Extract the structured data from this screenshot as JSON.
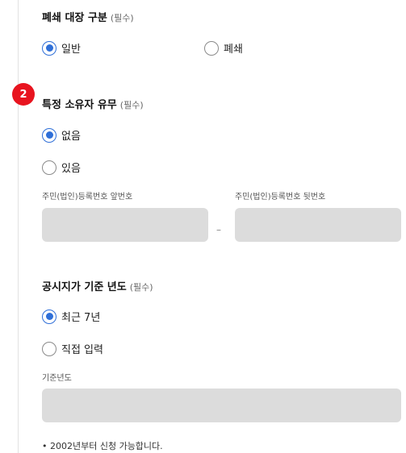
{
  "section_closure": {
    "title": "폐쇄 대장 구분",
    "required": "(필수)",
    "options": [
      "일반",
      "폐쇄"
    ],
    "selected": "일반"
  },
  "step_badge": "2",
  "section_owner": {
    "title": "특정 소유자 유무",
    "required": "(필수)",
    "options": [
      "없음",
      "있음"
    ],
    "selected": "없음",
    "front_label": "주민(법인)등록번호 앞번호",
    "back_label": "주민(법인)등록번호 뒷번호",
    "front_value": "",
    "back_value": "",
    "separator": "–"
  },
  "section_year": {
    "title": "공시지가 기준 년도",
    "required": "(필수)",
    "options": [
      "최근 7년",
      "직접 입력"
    ],
    "selected": "최근 7년",
    "year_label": "기준년도",
    "year_value": "",
    "note": "• 2002년부터 신청 가능합니다."
  },
  "colors": {
    "accent": "#2f6fd8",
    "badge": "#e8141f",
    "input_bg": "#dcdcdc"
  }
}
